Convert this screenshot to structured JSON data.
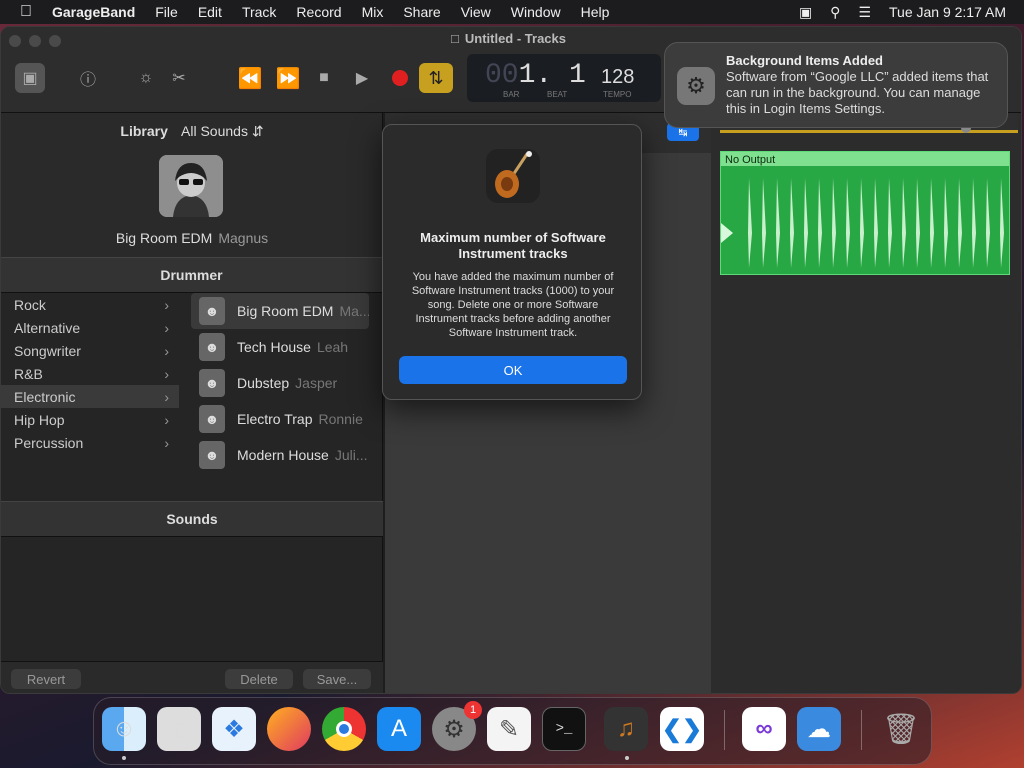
{
  "menubar": {
    "app": "GarageBand",
    "items": [
      "File",
      "Edit",
      "Track",
      "Record",
      "Mix",
      "Share",
      "View",
      "Window",
      "Help"
    ],
    "clock": "Tue Jan 9  2:17 AM"
  },
  "window": {
    "title": "Untitled - Tracks"
  },
  "lcd": {
    "bar_beat_dim": "00",
    "bar_beat": "1. 1",
    "tempo": "128",
    "bar_caption": "BAR",
    "beat_caption": "BEAT",
    "tempo_caption": "TEMPO"
  },
  "library": {
    "title": "Library",
    "filter": "All Sounds",
    "selected_name": "Big Room EDM",
    "selected_drummer": "Magnus",
    "drummer_section": "Drummer",
    "sounds_section": "Sounds",
    "genres": [
      {
        "label": "Rock",
        "selected": false
      },
      {
        "label": "Alternative",
        "selected": false
      },
      {
        "label": "Songwriter",
        "selected": false
      },
      {
        "label": "R&B",
        "selected": false
      },
      {
        "label": "Electronic",
        "selected": true
      },
      {
        "label": "Hip Hop",
        "selected": false
      },
      {
        "label": "Percussion",
        "selected": false
      }
    ],
    "drummers": [
      {
        "style": "Big Room EDM",
        "name": "Ma...",
        "selected": true
      },
      {
        "style": "Tech House",
        "name": "Leah",
        "selected": false
      },
      {
        "style": "Dubstep",
        "name": "Jasper",
        "selected": false
      },
      {
        "style": "Electro Trap",
        "name": "Ronnie",
        "selected": false
      },
      {
        "style": "Modern House",
        "name": "Juli...",
        "selected": false
      }
    ],
    "buttons": {
      "revert": "Revert",
      "delete": "Delete",
      "save": "Save..."
    }
  },
  "region": {
    "name": "No Output",
    "color": "#28a745"
  },
  "dialog": {
    "title": "Maximum number of Software Instrument tracks",
    "message": "You have added the maximum number of Software Instrument tracks (1000) to your song. Delete one or more Software Instrument tracks before adding another Software Instrument track.",
    "ok": "OK",
    "accent": "#1a73e8"
  },
  "notification": {
    "title": "Background Items Added",
    "body": "Software from “Google LLC” added items that can run in the background. You can manage this in Login Items Settings."
  },
  "dock": {
    "settings_badge": "1",
    "apps": [
      "finder-icon",
      "launchpad-icon",
      "safari-icon",
      "firefox-icon",
      "chrome-icon",
      "app-store-icon",
      "system-settings-icon",
      "textedit-icon",
      "terminal-icon",
      "garageband-icon",
      "vscode-icon",
      "visual-studio-icon",
      "weather-icon",
      "trash-icon"
    ]
  }
}
